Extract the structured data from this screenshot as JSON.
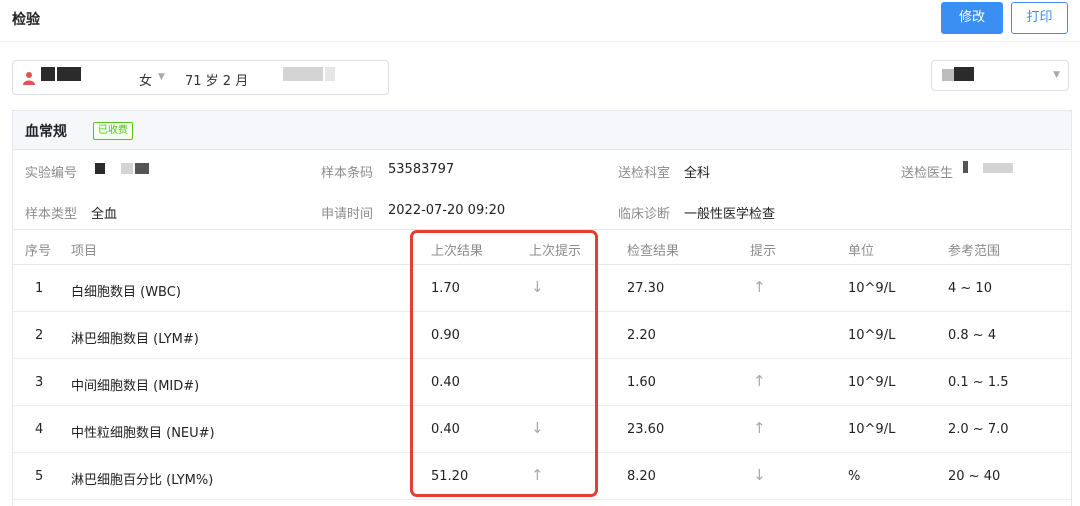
{
  "header": {
    "title": "检验",
    "edit_label": "修改",
    "print_label": "打印"
  },
  "patient": {
    "gender": "女",
    "age": "71 岁 2 月"
  },
  "card": {
    "title": "血常规",
    "badge": "已收费"
  },
  "info": {
    "lab_no_label": "实验编号",
    "barcode_label": "样本条码",
    "barcode_value": "53583797",
    "dept_label": "送检科室",
    "dept_value": "全科",
    "doctor_label": "送检医生",
    "sample_type_label": "样本类型",
    "sample_type_value": "全血",
    "request_time_label": "申请时间",
    "request_time_value": "2022-07-20 09:20",
    "diagnosis_label": "临床诊断",
    "diagnosis_value": "一般性医学检查"
  },
  "table": {
    "headers": {
      "no": "序号",
      "item": "项目",
      "last_result": "上次结果",
      "last_hint": "上次提示",
      "result": "检查结果",
      "hint": "提示",
      "unit": "单位",
      "range": "参考范围"
    },
    "rows": [
      {
        "no": "1",
        "item": "白细胞数目 (WBC)",
        "last_result": "1.70",
        "last_hint": "↓",
        "result": "27.30",
        "hint": "↑",
        "unit": "10^9/L",
        "range": "4 ~ 10"
      },
      {
        "no": "2",
        "item": "淋巴细胞数目 (LYM#)",
        "last_result": "0.90",
        "last_hint": "",
        "result": "2.20",
        "hint": "",
        "unit": "10^9/L",
        "range": "0.8 ~ 4"
      },
      {
        "no": "3",
        "item": "中间细胞数目 (MID#)",
        "last_result": "0.40",
        "last_hint": "",
        "result": "1.60",
        "hint": "↑",
        "unit": "10^9/L",
        "range": "0.1 ~ 1.5"
      },
      {
        "no": "4",
        "item": "中性粒细胞数目 (NEU#)",
        "last_result": "0.40",
        "last_hint": "↓",
        "result": "23.60",
        "hint": "↑",
        "unit": "10^9/L",
        "range": "2.0 ~ 7.0"
      },
      {
        "no": "5",
        "item": "淋巴细胞百分比 (LYM%)",
        "last_result": "51.20",
        "last_hint": "↑",
        "result": "8.20",
        "hint": "↓",
        "unit": "%",
        "range": "20 ~ 40"
      }
    ]
  },
  "colors": {
    "primary": "#3c8ff2",
    "highlight": "#e53d30",
    "badge": "#52c41a"
  }
}
